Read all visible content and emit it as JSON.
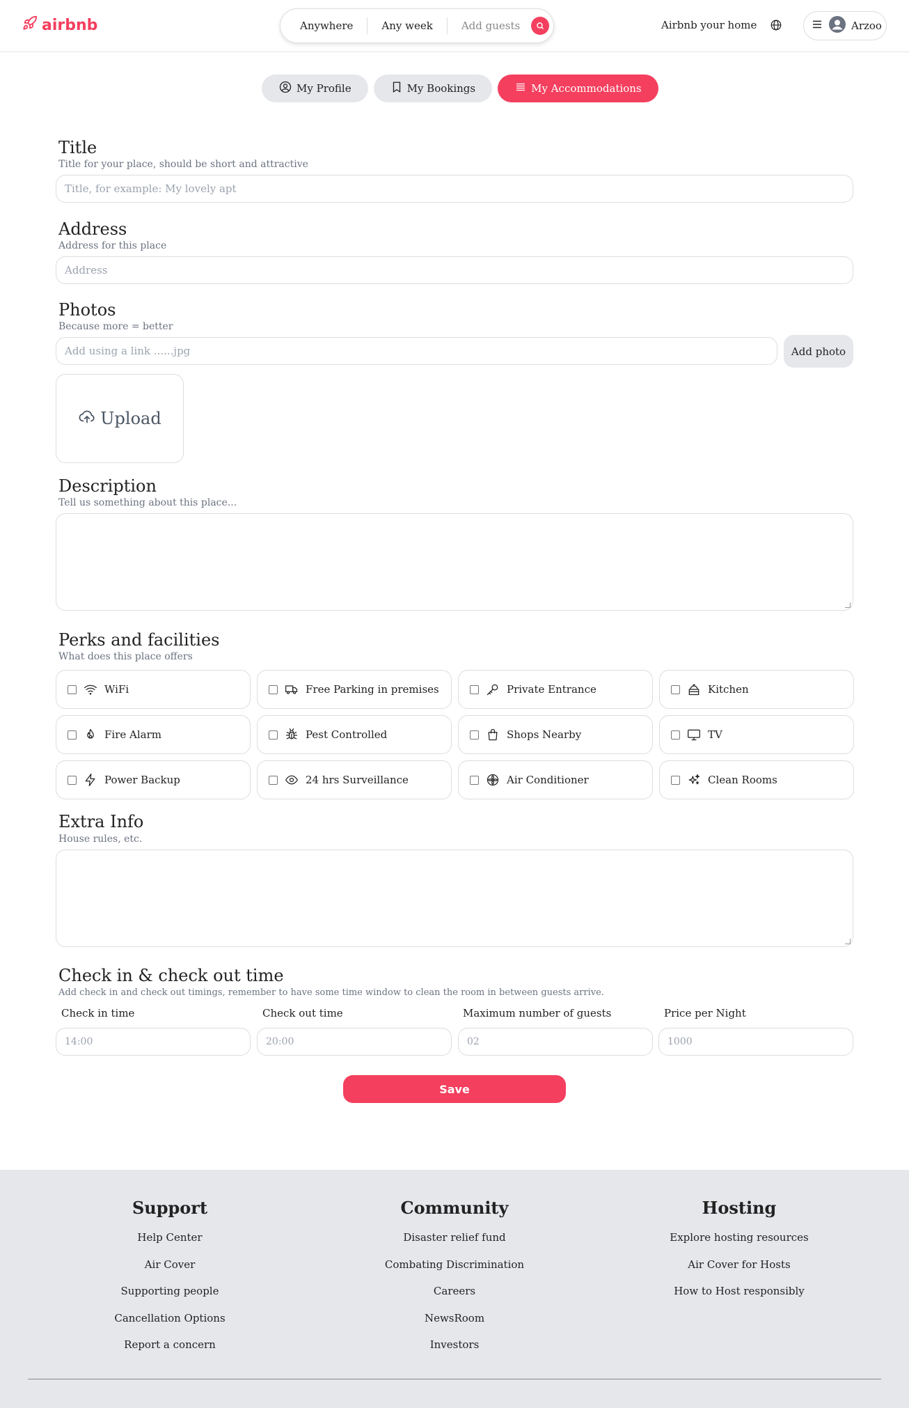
{
  "brand": {
    "name": "airbnb",
    "accent": "#f43f5e"
  },
  "search": {
    "where": "Anywhere",
    "when": "Any week",
    "guests": "Add guests"
  },
  "header": {
    "host_link": "Airbnb your home",
    "user_name": "Arzoo"
  },
  "nav": {
    "tabs": [
      {
        "label": "My Profile",
        "icon": "user-circle-icon"
      },
      {
        "label": "My Bookings",
        "icon": "bookmark-icon"
      },
      {
        "label": "My Accommodations",
        "icon": "list-icon",
        "active": true
      }
    ]
  },
  "form": {
    "title": {
      "heading": "Title",
      "sub": "Title for your place, should be short and attractive",
      "placeholder": "Title, for example: My lovely apt"
    },
    "address": {
      "heading": "Address",
      "sub": "Address for this place",
      "placeholder": "Address"
    },
    "photos": {
      "heading": "Photos",
      "sub": "Because more = better",
      "placeholder": "Add using a link ......jpg",
      "add_button": "Add photo",
      "upload_label": "Upload"
    },
    "description": {
      "heading": "Description",
      "sub": "Tell us something about this place..."
    },
    "perks": {
      "heading": "Perks and facilities",
      "sub": "What does this place offers",
      "items": [
        {
          "label": "WiFi",
          "icon": "wifi-icon"
        },
        {
          "label": "Free Parking in premises",
          "icon": "truck-icon"
        },
        {
          "label": "Private Entrance",
          "icon": "key-icon"
        },
        {
          "label": "Kitchen",
          "icon": "stove-icon"
        },
        {
          "label": "Fire Alarm",
          "icon": "fire-icon"
        },
        {
          "label": "Pest Controlled",
          "icon": "bug-icon"
        },
        {
          "label": "Shops Nearby",
          "icon": "shopping-bag-icon"
        },
        {
          "label": "TV",
          "icon": "tv-icon"
        },
        {
          "label": "Power Backup",
          "icon": "bolt-icon"
        },
        {
          "label": "24 hrs Surveillance",
          "icon": "eye-icon"
        },
        {
          "label": "Air Conditioner",
          "icon": "fan-icon"
        },
        {
          "label": "Clean Rooms",
          "icon": "sparkles-icon"
        }
      ]
    },
    "extra": {
      "heading": "Extra Info",
      "sub": "House rules, etc."
    },
    "checkin": {
      "heading": "Check in & check out time",
      "sub": "Add check in and check out timings, remember to have some time window to clean the room in between guests arrive.",
      "fields": [
        {
          "label": "Check in time",
          "placeholder": "14:00"
        },
        {
          "label": "Check out time",
          "placeholder": "20:00"
        },
        {
          "label": "Maximum number of guests",
          "placeholder": "02"
        },
        {
          "label": "Price per Night",
          "placeholder": "1000"
        }
      ]
    },
    "save_label": "Save"
  },
  "footer": {
    "support": {
      "title": "Support",
      "links": [
        "Help Center",
        "Air Cover",
        "Supporting people",
        "Cancellation Options",
        "Report a concern"
      ]
    },
    "community": {
      "title": "Community",
      "links": [
        "Disaster relief fund",
        "Combating Discrimination",
        "Careers",
        "NewsRoom",
        "Investors"
      ]
    },
    "hosting": {
      "title": "Hosting",
      "links": [
        "Explore hosting resources",
        "Air Cover for Hosts",
        "How to Host responsibly"
      ]
    }
  }
}
